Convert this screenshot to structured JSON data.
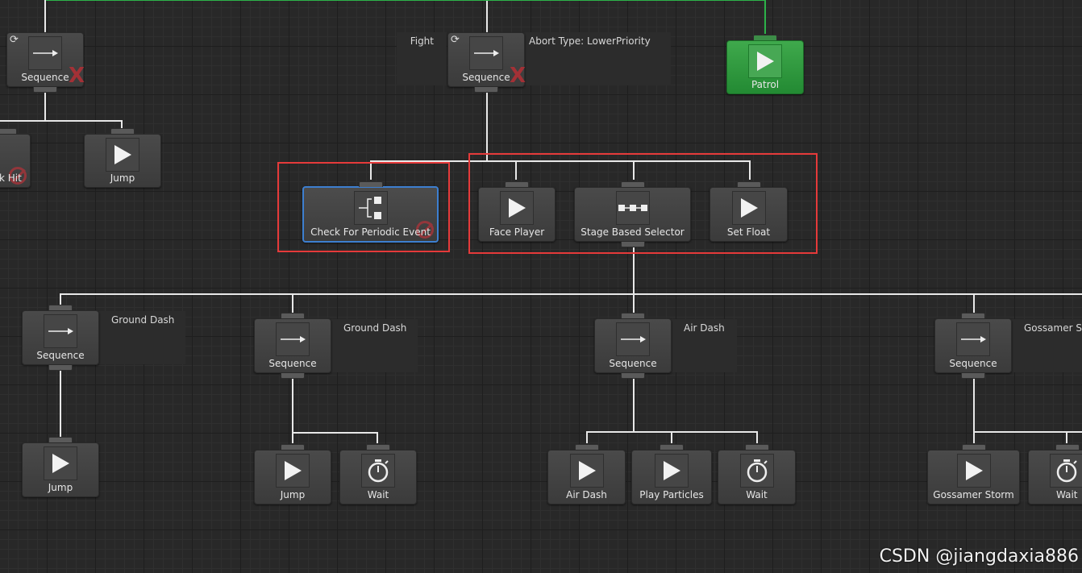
{
  "nodes": {
    "seq_left": {
      "label": "Sequence",
      "type": "sequence"
    },
    "seq_fight": {
      "label": "Sequence",
      "type": "sequence"
    },
    "patrol": {
      "label": "Patrol",
      "type": "action"
    },
    "hit_partial": {
      "label": "k Hit",
      "type": "action"
    },
    "jump_top": {
      "label": "Jump",
      "type": "action"
    },
    "check_periodic": {
      "label": "Check For Periodic Event",
      "type": "conditional"
    },
    "face_player": {
      "label": "Face Player",
      "type": "action"
    },
    "stage_selector": {
      "label": "Stage Based Selector",
      "type": "selector"
    },
    "set_float": {
      "label": "Set Float",
      "type": "action"
    },
    "seq_ground1": {
      "label": "Sequence",
      "type": "sequence"
    },
    "seq_ground2": {
      "label": "Sequence",
      "type": "sequence"
    },
    "seq_air": {
      "label": "Sequence",
      "type": "sequence"
    },
    "seq_gossamer": {
      "label": "Sequence",
      "type": "sequence"
    },
    "jump_g1": {
      "label": "Jump",
      "type": "action"
    },
    "jump_g2": {
      "label": "Jump",
      "type": "action"
    },
    "wait_g2": {
      "label": "Wait",
      "type": "wait"
    },
    "air_dash": {
      "label": "Air Dash",
      "type": "action"
    },
    "play_particles": {
      "label": "Play Particles",
      "type": "action"
    },
    "wait_air": {
      "label": "Wait",
      "type": "wait"
    },
    "gossamer_storm": {
      "label": "Gossamer Storm",
      "type": "action"
    },
    "wait_gos": {
      "label": "Wait",
      "type": "wait"
    }
  },
  "comments": {
    "fight": "Fight",
    "abort_type": "Abort Type:  LowerPriority",
    "ground_dash_1": "Ground Dash",
    "ground_dash_2": "Ground Dash",
    "air_dash": "Air Dash",
    "gossamer": "Gossamer St"
  },
  "icons": {
    "sequence": "arrow-right-icon",
    "action": "play-icon",
    "wait": "stopwatch-icon",
    "selector": "stage-selector-icon",
    "conditional": "branch-icon",
    "abort": "reload-icon",
    "disabled": "red-x-icon"
  },
  "colors": {
    "background": "#282828",
    "node": "#444444",
    "wire": "#e8e8e8",
    "active": "#2ea043",
    "selected_border": "#3d7fd0",
    "highlight_box": "#e53a3a"
  },
  "watermark": "CSDN @jiangdaxia886"
}
